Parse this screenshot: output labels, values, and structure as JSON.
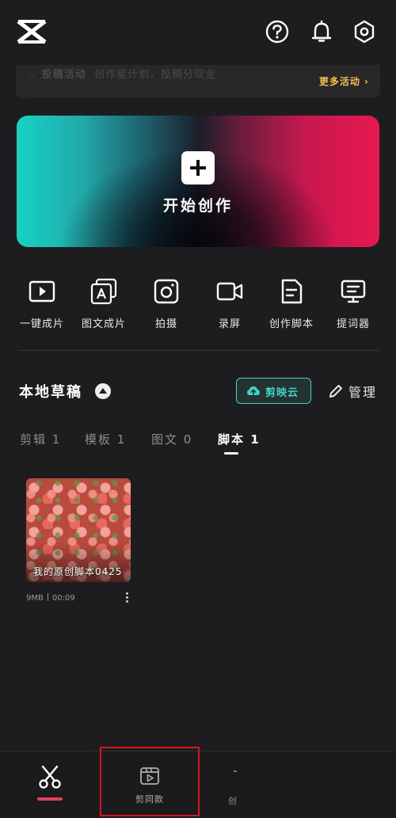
{
  "header": {
    "logo_icon": "capcut-logo-icon",
    "help_icon": "help-circle-icon",
    "notification_icon": "bell-icon",
    "settings_icon": "hexagon-settings-icon"
  },
  "banner": {
    "activity_label": "投稿活动",
    "activity_text": "创作星计划，投稿分现金",
    "more_label": "更多活动 ›"
  },
  "hero": {
    "plus_icon": "plus-icon",
    "label": "开始创作"
  },
  "tools": [
    {
      "label": "一键成片",
      "icon": "play-frame-icon"
    },
    {
      "label": "图文成片",
      "icon": "text-frames-icon"
    },
    {
      "label": "拍摄",
      "icon": "camera-icon"
    },
    {
      "label": "录屏",
      "icon": "video-camera-icon"
    },
    {
      "label": "创作脚本",
      "icon": "script-document-icon"
    },
    {
      "label": "提词器",
      "icon": "teleprompter-icon"
    }
  ],
  "drafts": {
    "title": "本地草稿",
    "cloud_label": "剪映云",
    "manage_label": "管理",
    "tabs": [
      {
        "label": "剪辑 1",
        "active": false
      },
      {
        "label": "模板 1",
        "active": false
      },
      {
        "label": "图文 0",
        "active": false
      },
      {
        "label": "脚本 1",
        "active": true
      }
    ],
    "items": [
      {
        "title": "我的原创脚本0425",
        "size": "9MB",
        "duration": "00:09"
      }
    ]
  },
  "bottom_nav": {
    "items": [
      {
        "label": "",
        "icon": "scissors-icon",
        "active": true
      },
      {
        "label": "剪同款",
        "icon": "clapperboard-play-icon",
        "active": false
      },
      {
        "label": "创",
        "icon": "create-icon",
        "active": false
      }
    ]
  },
  "colors": {
    "background": "#1d1d1f",
    "accent_teal": "#3bd6c6",
    "accent_red": "#e61950",
    "highlight_yellow": "#f3c24a",
    "active_indicator": "#e0405a",
    "annotation_box": "#d4161e"
  }
}
